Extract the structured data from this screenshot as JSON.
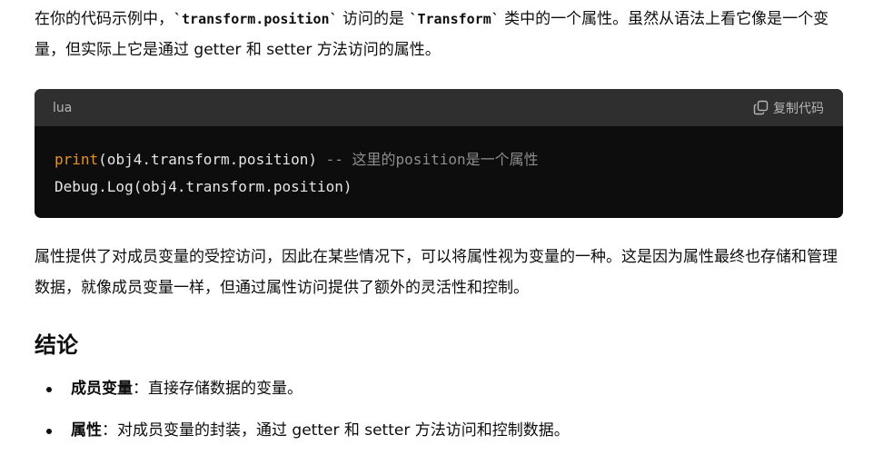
{
  "intro": {
    "part1": "在你的代码示例中，",
    "code1": "`transform.position`",
    "part2": " 访问的是 ",
    "code2": "`Transform`",
    "part3": " 类中的一个属性。虽然从语法上看它像是一个变量，但实际上它是通过 getter 和 setter 方法访问的属性。"
  },
  "code_block": {
    "language": "lua",
    "copy_label": "复制代码",
    "copy_icon": "copy-icon",
    "line1_func": "print",
    "line1_rest": "(obj4.transform.position)",
    "line1_comment": "-- 这里的position是一个属性",
    "line2": "Debug.Log(obj4.transform.position)"
  },
  "paragraph2": "属性提供了对成员变量的受控访问，因此在某些情况下，可以将属性视为变量的一种。这是因为属性最终也存储和管理数据，就像成员变量一样，但通过属性访问提供了额外的灵活性和控制。",
  "conclusion": {
    "heading": "结论",
    "items": [
      {
        "term": "成员变量",
        "desc": "：直接存储数据的变量。"
      },
      {
        "term": "属性",
        "desc": "：对成员变量的封装，通过 getter 和 setter 方法访问和控制数据。"
      }
    ]
  },
  "colors": {
    "code_bg": "#0d0d0d",
    "code_header_bg": "#2f2f2f",
    "keyword": "#e9950c",
    "comment": "#8e8e8e"
  }
}
